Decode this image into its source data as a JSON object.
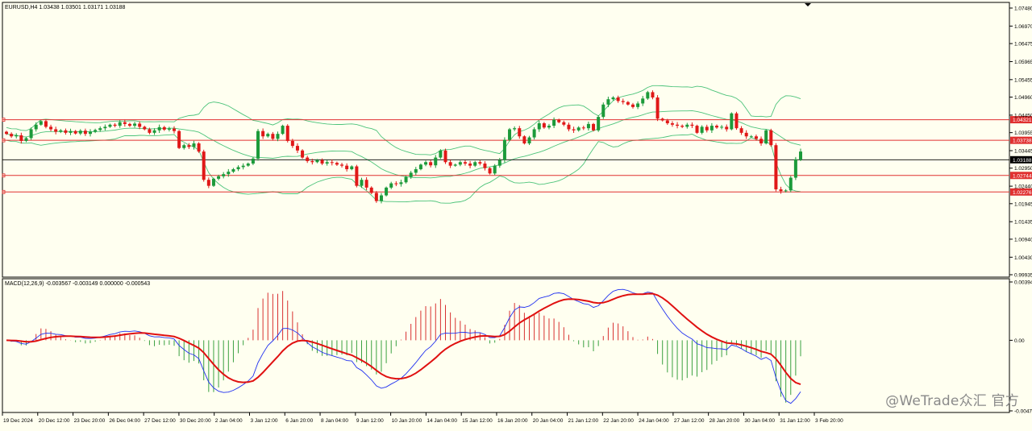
{
  "symbol_header": "EURUSD,H4  1.03438 1.03501 1.03171 1.03188",
  "macd_header": "MACD(12,26,9) -0.003567 -0.003149 0.000000 -0.000543",
  "watermark": "@WeTrade众汇 官方",
  "colors": {
    "background": "#fffff0",
    "bull_candle": "#1c9a3a",
    "bear_candle": "#e01818",
    "bollinger": "#4cc37a",
    "level_line": "#e03030",
    "current_price_line": "#000000",
    "macd_line": "#2030f0",
    "signal_line": "#e01010",
    "hist_up": "#d83030",
    "hist_down": "#3aa040"
  },
  "chart_data": [
    {
      "type": "candlestick",
      "title": "EURUSD,H4",
      "ohlc_last": {
        "open": 1.03438,
        "high": 1.03501,
        "low": 1.03171,
        "close": 1.03188
      },
      "ylim": [
        0.99935,
        1.0748
      ],
      "y_ticks": [
        "1.07480",
        "1.06970",
        "1.06475",
        "1.05965",
        "1.05455",
        "1.04960",
        "1.04450",
        "1.03955",
        "1.03445",
        "1.02950",
        "1.02440",
        "1.01945",
        "1.01435",
        "1.00940",
        "1.00430",
        "0.99935"
      ],
      "x_labels": [
        "19 Dec 2024",
        "20 Dec 12:00",
        "23 Dec 20:00",
        "26 Dec 04:00",
        "27 Dec 12:00",
        "30 Dec 20:00",
        "2 Jan 04:00",
        "3 Jan 12:00",
        "6 Jan 20:00",
        "8 Jan 04:00",
        "9 Jan 12:00",
        "10 Jan 20:00",
        "14 Jan 04:00",
        "15 Jan 12:00",
        "16 Jan 20:00",
        "20 Jan 04:00",
        "21 Jan 12:00",
        "22 Jan 20:00",
        "24 Jan 04:00",
        "27 Jan 12:00",
        "28 Jan 20:00",
        "30 Jan 04:00",
        "31 Jan 12:00",
        "3 Feb 20:00"
      ],
      "levels": [
        {
          "label": "1.04321",
          "value": 1.04321
        },
        {
          "label": "1.03738",
          "value": 1.03738
        },
        {
          "label": "1.02744",
          "value": 1.02744
        },
        {
          "label": "1.02276",
          "value": 1.02276
        }
      ],
      "current_price": {
        "label": "1.03188",
        "value": 1.03188
      },
      "closes": [
        1.0392,
        1.0385,
        1.0388,
        1.0372,
        1.038,
        1.0405,
        1.0418,
        1.0428,
        1.0412,
        1.0405,
        1.0398,
        1.0402,
        1.0395,
        1.04,
        1.0393,
        1.0401,
        1.0392,
        1.0398,
        1.0403,
        1.0408,
        1.0412,
        1.0418,
        1.0415,
        1.0425,
        1.042,
        1.0415,
        1.0421,
        1.0412,
        1.0405,
        1.0395,
        1.0402,
        1.0411,
        1.0404,
        1.0407,
        1.04,
        1.0352,
        1.036,
        1.0355,
        1.0365,
        1.0342,
        1.0262,
        1.0245,
        1.0265,
        1.0272,
        1.0278,
        1.0285,
        1.0292,
        1.0298,
        1.0302,
        1.0308,
        1.0322,
        1.04,
        1.0385,
        1.0392,
        1.0378,
        1.0392,
        1.0415,
        1.0372,
        1.0358,
        1.0345,
        1.0325,
        1.0315,
        1.0312,
        1.0318,
        1.0308,
        1.0312,
        1.031,
        1.0305,
        1.0302,
        1.0292,
        1.03,
        1.0245,
        1.0262,
        1.024,
        1.0225,
        1.0202,
        1.0218,
        1.024,
        1.0252,
        1.025,
        1.0255,
        1.027,
        1.0282,
        1.0292,
        1.0305,
        1.0312,
        1.0303,
        1.0325,
        1.0345,
        1.0312,
        1.0302,
        1.0305,
        1.0312,
        1.0308,
        1.0302,
        1.0312,
        1.0308,
        1.0295,
        1.028,
        1.0302,
        1.0318,
        1.0375,
        1.0405,
        1.0408,
        1.0385,
        1.0365,
        1.0382,
        1.0405,
        1.0422,
        1.041,
        1.0415,
        1.0432,
        1.0425,
        1.0418,
        1.0405,
        1.0402,
        1.041,
        1.0408,
        1.042,
        1.0402,
        1.044,
        1.0475,
        1.049,
        1.0495,
        1.0485,
        1.0482,
        1.0475,
        1.0468,
        1.0478,
        1.0492,
        1.051,
        1.0495,
        1.0435,
        1.043,
        1.0422,
        1.0418,
        1.0415,
        1.0412,
        1.0418,
        1.0415,
        1.0395,
        1.0412,
        1.0402,
        1.0415,
        1.041,
        1.0412,
        1.0405,
        1.045,
        1.0408,
        1.0395,
        1.0385,
        1.0385,
        1.0378,
        1.0365,
        1.0402,
        1.036,
        1.0235,
        1.023,
        1.0232,
        1.0268,
        1.032,
        1.0342
      ]
    },
    {
      "type": "line",
      "title": "MACD(12,26,9)",
      "values": {
        "macd": -0.003567,
        "signal": -0.003149,
        "zero": 0.0,
        "histogram": -0.000543
      },
      "y_ticks": [
        "0.003949",
        "0.00",
        "-0.004778"
      ],
      "ylim": [
        -0.004778,
        0.003949
      ]
    }
  ]
}
